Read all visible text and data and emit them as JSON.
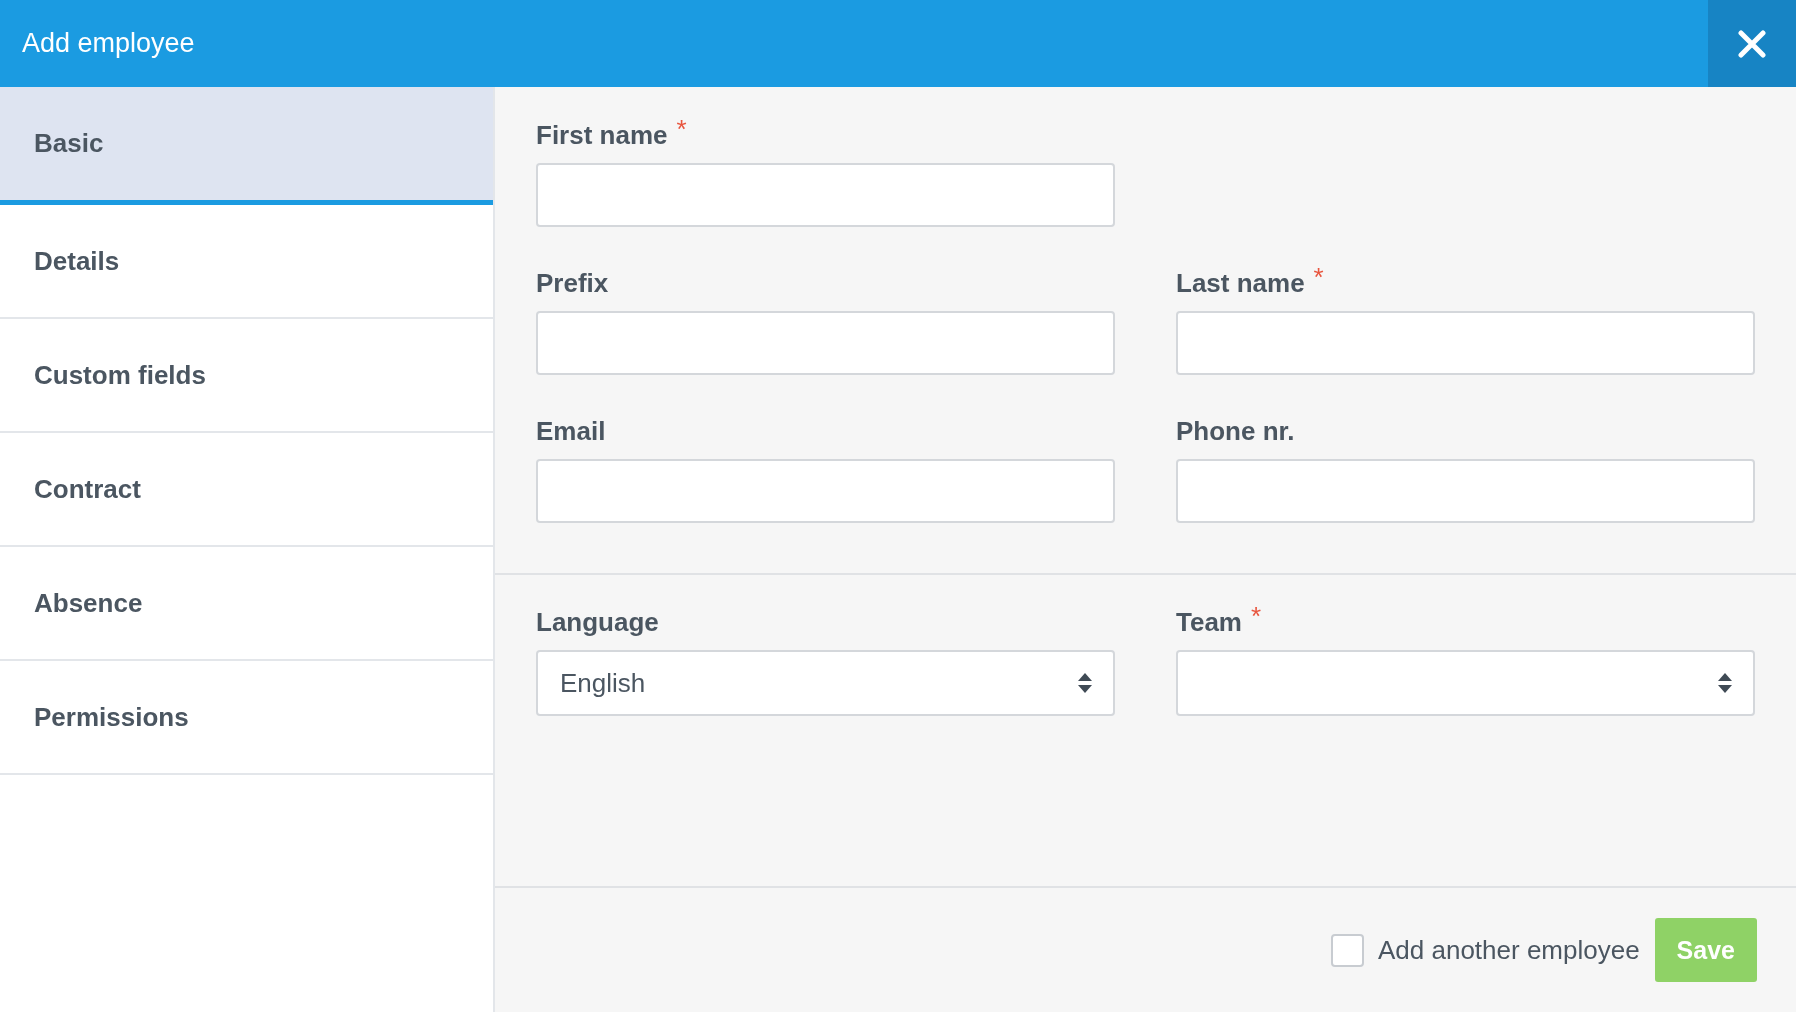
{
  "header": {
    "title": "Add employee"
  },
  "tabs": [
    {
      "label": "Basic",
      "selected": true
    },
    {
      "label": "Details",
      "selected": false
    },
    {
      "label": "Custom fields",
      "selected": false
    },
    {
      "label": "Contract",
      "selected": false
    },
    {
      "label": "Absence",
      "selected": false
    },
    {
      "label": "Permissions",
      "selected": false
    }
  ],
  "required_mark": "*",
  "sections": [
    {
      "rows": [
        [
          {
            "kind": "text",
            "label": "First name",
            "required": true
          }
        ],
        [
          {
            "kind": "text",
            "label": "Prefix",
            "required": false
          },
          {
            "kind": "text",
            "label": "Last name",
            "required": true
          }
        ],
        [
          {
            "kind": "text",
            "label": "Email",
            "required": false
          },
          {
            "kind": "text",
            "label": "Phone nr.",
            "required": false
          }
        ]
      ]
    },
    {
      "rows": [
        [
          {
            "kind": "select",
            "label": "Language",
            "required": false,
            "value": "English"
          },
          {
            "kind": "select",
            "label": "Team",
            "required": true
          }
        ]
      ]
    }
  ],
  "footer": {
    "add_another": {
      "label": "Add another employee",
      "checked": false
    },
    "save": "Save"
  }
}
